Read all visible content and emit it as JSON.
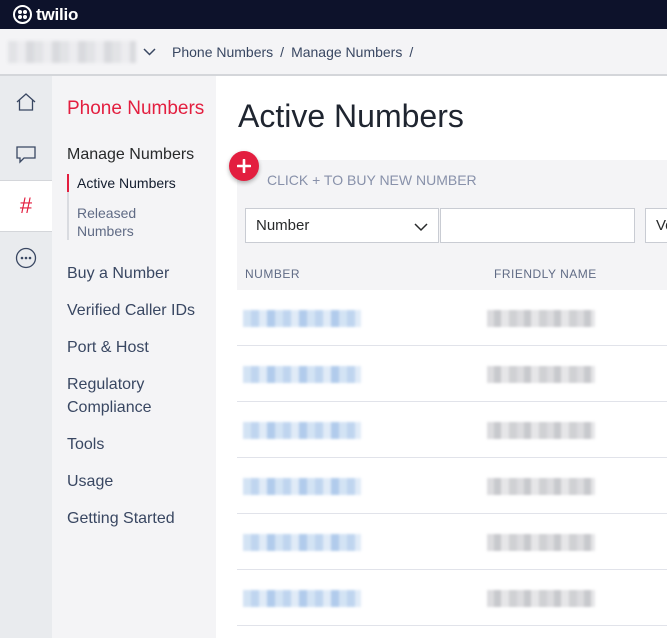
{
  "brand": {
    "name": "twilio",
    "color": "#0d122b",
    "accent": "#e31e3f"
  },
  "breadcrumb": {
    "account_chevron_icon": "chevron-down-icon",
    "items": [
      "Phone Numbers",
      "Manage Numbers"
    ],
    "separator": "/"
  },
  "rail": {
    "items": [
      {
        "icon": "home-icon"
      },
      {
        "icon": "chat-icon"
      },
      {
        "icon": "hash-icon",
        "glyph": "#",
        "active": true
      },
      {
        "icon": "more-icon"
      }
    ]
  },
  "subnav": {
    "title": "Phone Numbers",
    "section": "Manage Numbers",
    "children": [
      "Active Numbers",
      "Released Numbers"
    ],
    "links": [
      "Buy a Number",
      "Verified Caller IDs",
      "Port & Host",
      "Regulatory Compliance",
      "Tools",
      "Usage",
      "Getting Started"
    ]
  },
  "main": {
    "title": "Active Numbers",
    "buy_label": "CLICK + TO BUY NEW NUMBER",
    "filter": {
      "selected": "Number",
      "second_select_partial": "Vo"
    },
    "table": {
      "headers": [
        "NUMBER",
        "FRIENDLY NAME"
      ],
      "row_count": 6
    }
  }
}
